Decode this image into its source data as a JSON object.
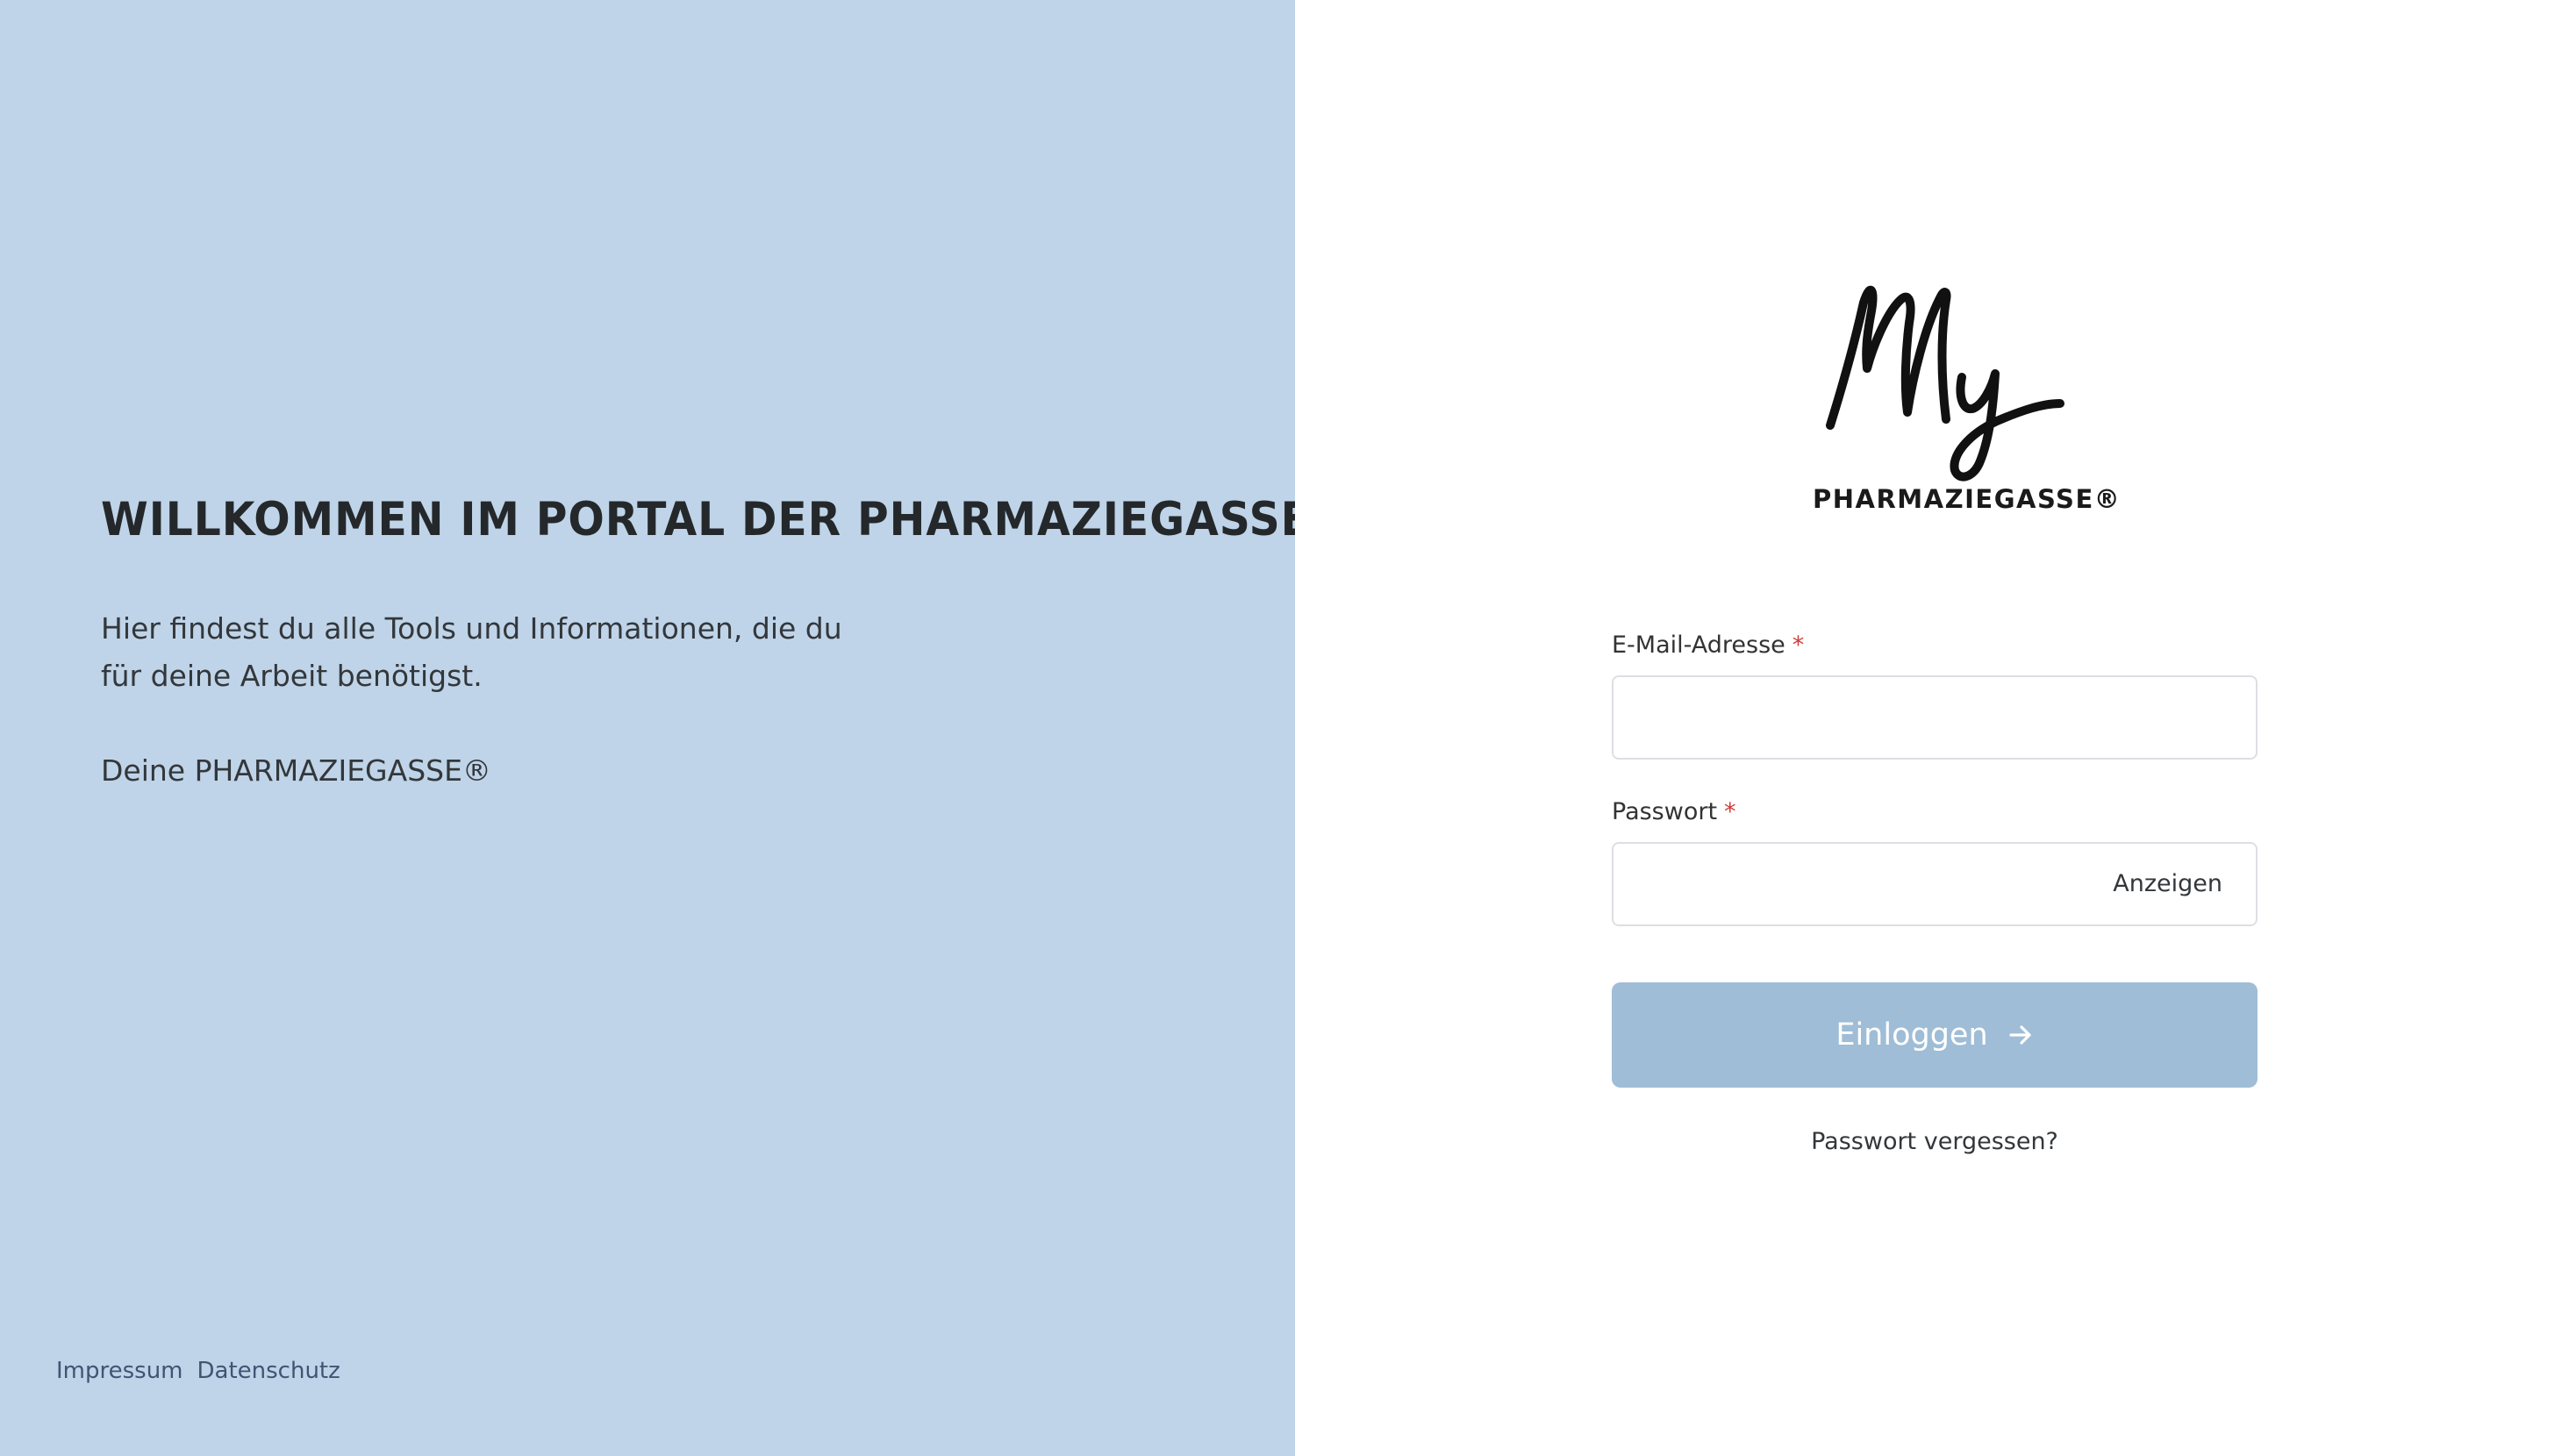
{
  "left": {
    "title": "WILLKOMMEN IM PORTAL DER PHARMAZIEGASSE®",
    "text": "Hier findest du alle Tools und Informationen, die du für deine Arbeit benötigst.",
    "signature": "Deine PHARMAZIEGASSE®",
    "background_color": "#bfd4e8"
  },
  "footer": {
    "impressum": "Impressum",
    "datenschutz": "Datenschutz"
  },
  "logo": {
    "script": "My",
    "wordmark": "PHARMAZIEGASSE®"
  },
  "form": {
    "email_label": "E-Mail-Adresse",
    "email_value": "",
    "password_label": "Passwort",
    "password_value": "",
    "required_marker": "*",
    "show_password": "Anzeigen",
    "submit_label": "Einloggen",
    "submit_icon": "arrow-right-icon",
    "forgot_password": "Passwort vergessen?",
    "button_color": "#9fbdd6",
    "required_color": "#d43a3a"
  }
}
